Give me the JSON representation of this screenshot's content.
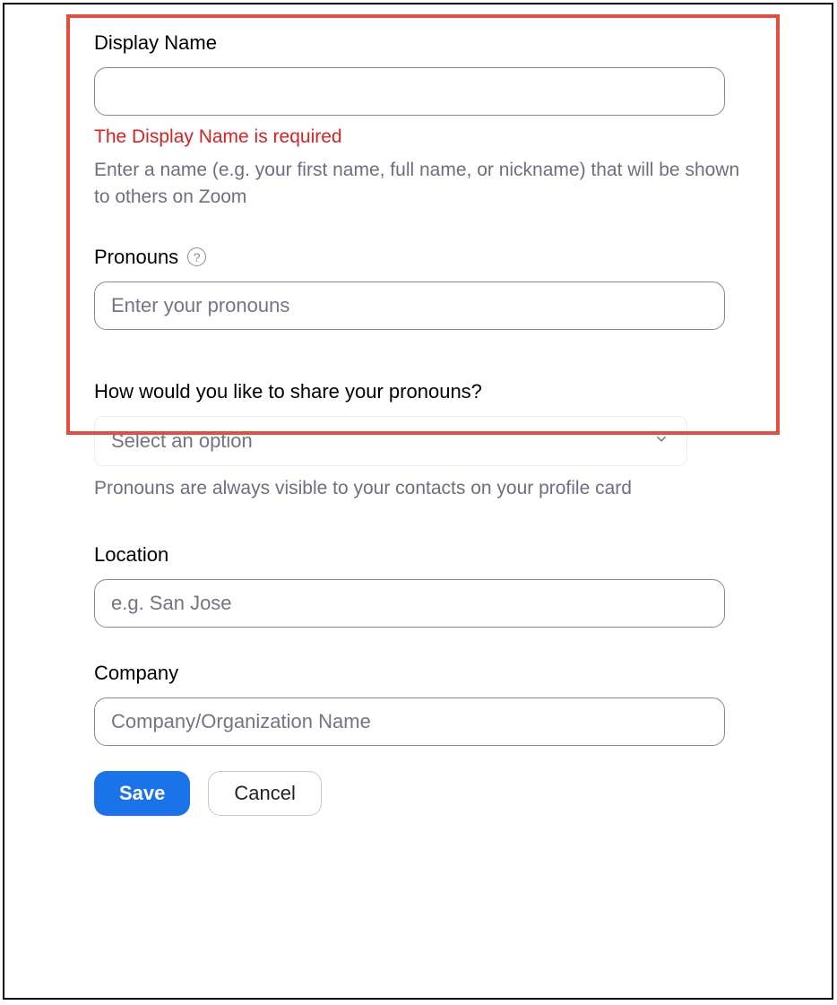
{
  "form": {
    "displayName": {
      "label": "Display Name",
      "value": "",
      "error": "The Display Name is required",
      "help": "Enter a name (e.g. your first name, full name, or nickname) that will be shown to others on Zoom"
    },
    "pronouns": {
      "label": "Pronouns",
      "placeholder": "Enter your pronouns",
      "value": "",
      "helpIconGlyph": "?"
    },
    "pronounsShare": {
      "label": "How would you like to share your pronouns?",
      "placeholder": "Select an option",
      "help": "Pronouns are always visible to your contacts on your profile card"
    },
    "location": {
      "label": "Location",
      "placeholder": "e.g. San Jose",
      "value": ""
    },
    "company": {
      "label": "Company",
      "placeholder": "Company/Organization Name",
      "value": ""
    },
    "buttons": {
      "save": "Save",
      "cancel": "Cancel"
    }
  }
}
